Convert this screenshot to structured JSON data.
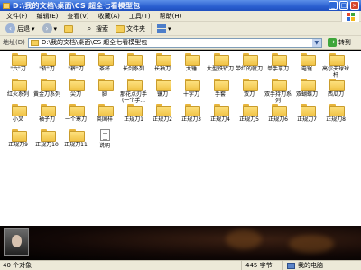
{
  "window": {
    "title": "D:\\我的文档\\桌面\\CS 超全七看模型包",
    "buttons": {
      "minimize": "_",
      "maximize": "□",
      "close": "×"
    }
  },
  "menu": [
    "文件(F)",
    "编辑(E)",
    "查看(V)",
    "收藏(A)",
    "工具(T)",
    "帮助(H)"
  ],
  "toolbar": {
    "back_label": "后退",
    "search_label": "搜索",
    "folders_label": "文件夹"
  },
  "address": {
    "label": "地址(D)",
    "value": "D:\\我的文档\\桌面\\CS 超全七看模型包",
    "go_label": "转到"
  },
  "items": [
    {
      "name": "\"六\"刀",
      "type": "folder"
    },
    {
      "name": "\"祈\"刀",
      "type": "folder"
    },
    {
      "name": "\"裤\"刀",
      "type": "folder"
    },
    {
      "name": "茶杯",
      "type": "folder"
    },
    {
      "name": "长剑系列",
      "type": "folder"
    },
    {
      "name": "长袖刀",
      "type": "folder"
    },
    {
      "name": "大锤",
      "type": "folder"
    },
    {
      "name": "大型铁铲刀",
      "type": "folder"
    },
    {
      "name": "带红的就刀",
      "type": "folder"
    },
    {
      "name": "单手拿刀",
      "type": "folder"
    },
    {
      "name": "电锯",
      "type": "folder"
    },
    {
      "name": "高尔夫球球杆",
      "type": "folder"
    },
    {
      "name": "红火系列",
      "type": "folder"
    },
    {
      "name": "黄金刀系列",
      "type": "folder"
    },
    {
      "name": "尖刀",
      "type": "folder"
    },
    {
      "name": "脚",
      "type": "folder"
    },
    {
      "name": "那花点刃手(一个手...",
      "type": "folder"
    },
    {
      "name": "镰刀",
      "type": "folder"
    },
    {
      "name": "十字刀",
      "type": "folder"
    },
    {
      "name": "手套",
      "type": "folder"
    },
    {
      "name": "双刀",
      "type": "folder"
    },
    {
      "name": "双手持刀系列",
      "type": "folder"
    },
    {
      "name": "双蝴蝶刀",
      "type": "folder"
    },
    {
      "name": "西瓜刀",
      "type": "folder"
    },
    {
      "name": "小叉",
      "type": "folder"
    },
    {
      "name": "袖子刀",
      "type": "folder"
    },
    {
      "name": "一个寒刀",
      "type": "folder"
    },
    {
      "name": "英国样",
      "type": "folder"
    },
    {
      "name": "正规刀1",
      "type": "folder"
    },
    {
      "name": "正规刀2",
      "type": "folder"
    },
    {
      "name": "正规刀3",
      "type": "folder"
    },
    {
      "name": "正规刀4",
      "type": "folder"
    },
    {
      "name": "正规刀5",
      "type": "folder"
    },
    {
      "name": "正规刀6",
      "type": "folder"
    },
    {
      "name": "正规刀7",
      "type": "folder"
    },
    {
      "name": "正规刀8",
      "type": "folder"
    },
    {
      "name": "正规刀9",
      "type": "folder"
    },
    {
      "name": "正规刀10",
      "type": "folder"
    },
    {
      "name": "正规刀11",
      "type": "folder"
    },
    {
      "name": "说明",
      "type": "document"
    }
  ],
  "status": {
    "objects": "40 个对象",
    "size": "445 字节",
    "location": "我的电脑"
  },
  "colors": {
    "titlebar": "#2a5fd0",
    "chrome": "#ece9d8",
    "folder": "#f1c448",
    "go": "#3fa63b"
  }
}
